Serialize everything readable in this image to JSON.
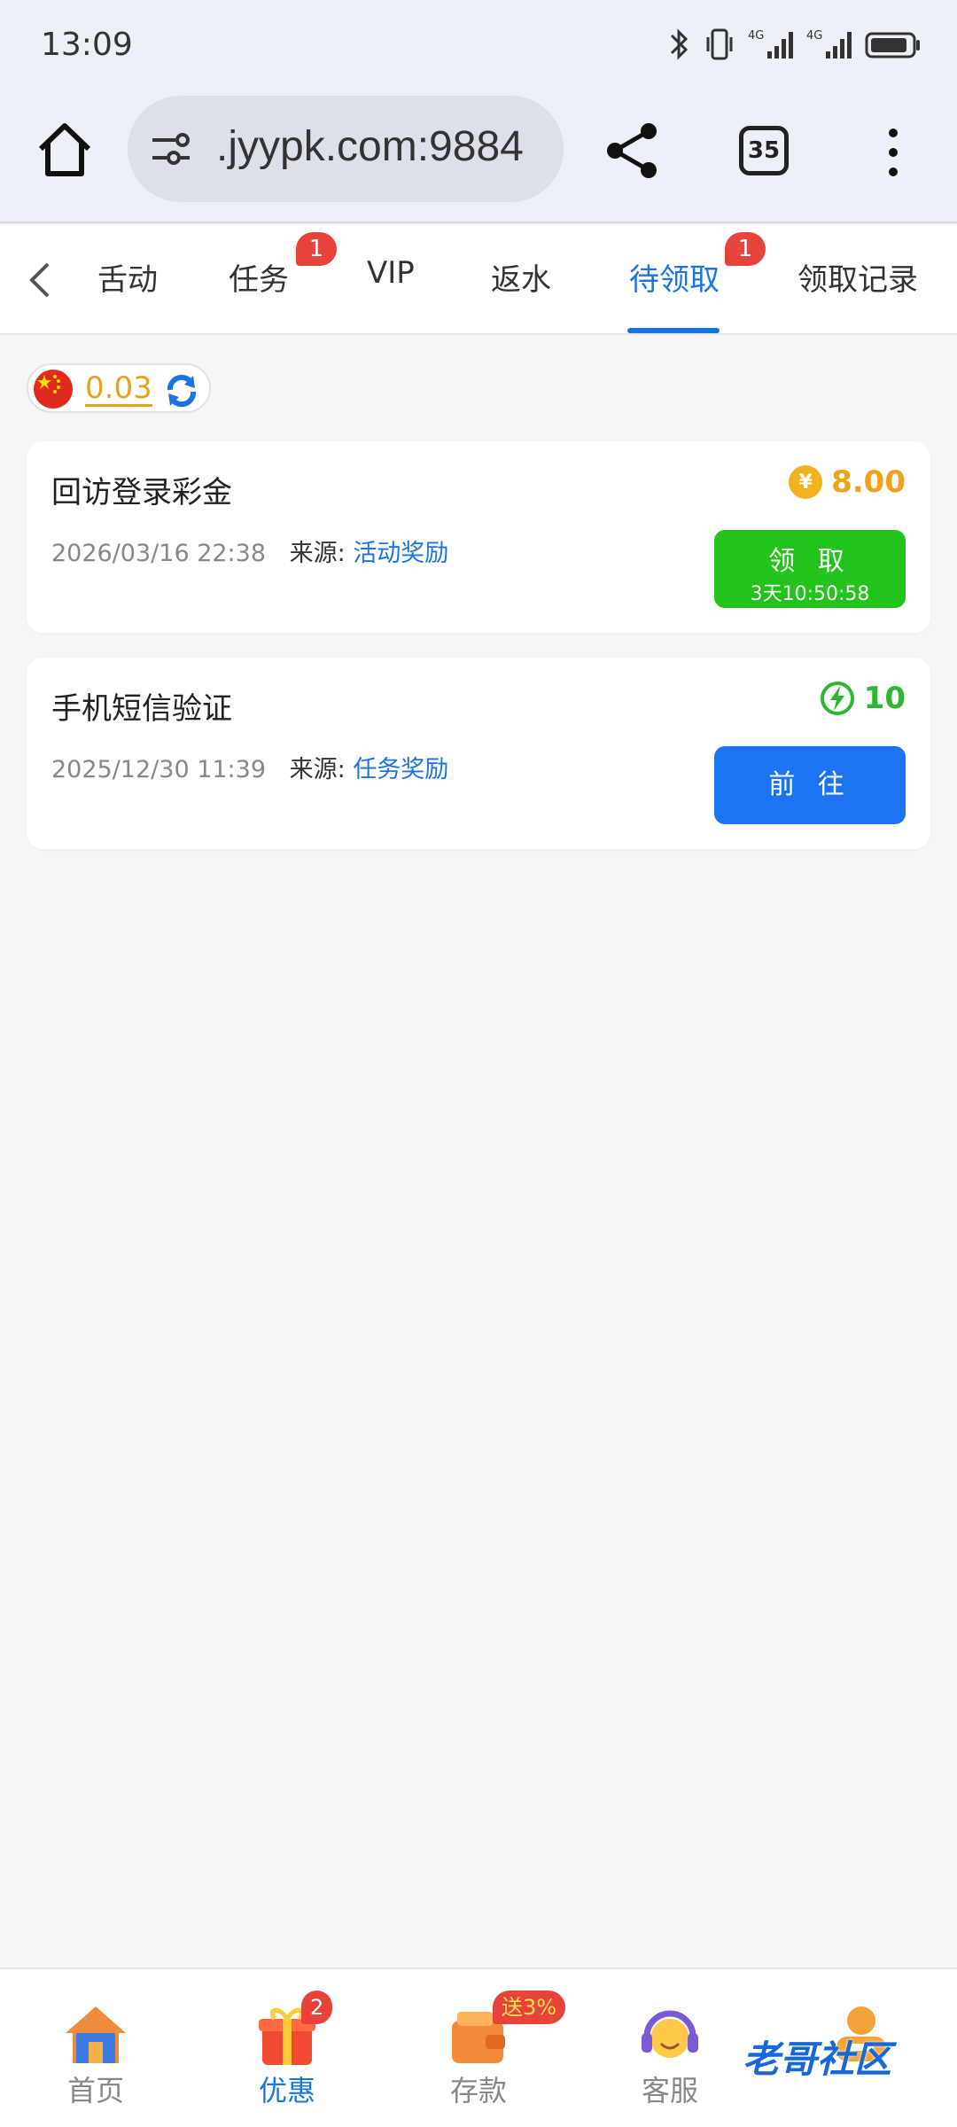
{
  "status_bar": {
    "time": "13:09"
  },
  "browser": {
    "url": ".jyypk.com:9884",
    "tab_count": "35"
  },
  "tabs": [
    {
      "label": "舌动"
    },
    {
      "label": "任务",
      "badge": "1"
    },
    {
      "label": "VIP"
    },
    {
      "label": "返水"
    },
    {
      "label": "待领取",
      "badge": "1"
    },
    {
      "label": "领取记录"
    }
  ],
  "active_tab": "待领取",
  "balance": {
    "value": "0.03"
  },
  "rewards": [
    {
      "title": "回访登录彩金",
      "date": "2026/03/16 22:38",
      "source_label": "来源:",
      "source": "活动奖励",
      "amount": "8.00",
      "amount_icon": "yuan-coin-icon",
      "amount_icon_text": "¥",
      "button_label": "领 取",
      "button_sub": "3天10:50:58",
      "button_color": "#22c41b"
    },
    {
      "title": "手机短信验证",
      "date": "2025/12/30 11:39",
      "source_label": "来源:",
      "source": "任务奖励",
      "amount": "10",
      "amount_icon": "lightning-icon",
      "button_label": "前 往",
      "button_color": "#1c74f3"
    }
  ],
  "bottom_nav": [
    {
      "label": "首页",
      "icon": "house-icon"
    },
    {
      "label": "优惠",
      "icon": "gift-icon",
      "badge": "2"
    },
    {
      "label": "存款",
      "icon": "wallet-icon",
      "badge": "送3%"
    },
    {
      "label": "客服",
      "icon": "headset-icon"
    },
    {
      "label": "我的",
      "icon": "user-icon"
    }
  ],
  "watermark": "老哥社区"
}
